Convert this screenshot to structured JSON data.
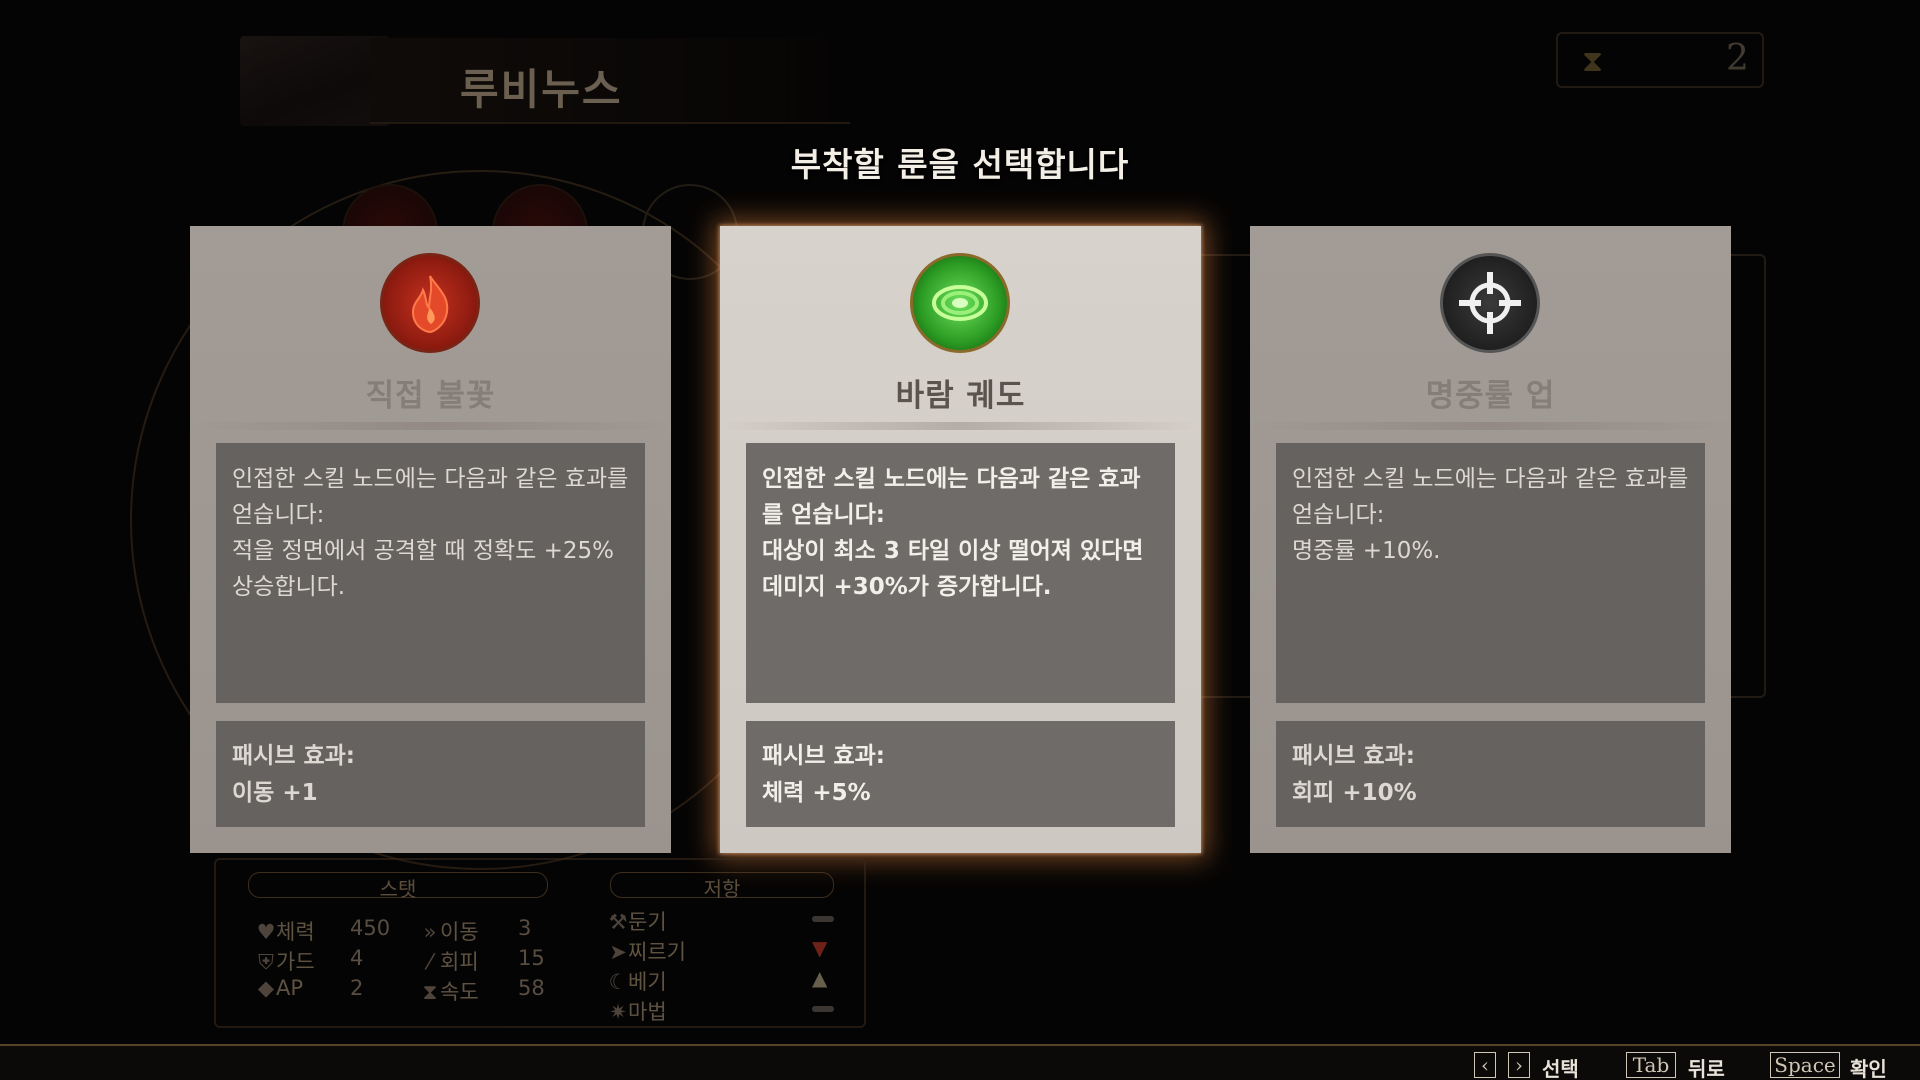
{
  "header": {
    "character_name": "루비누스",
    "currency_count": "2",
    "currency_icon": "hourglass-icon"
  },
  "title": "부착할 룬을 선택합니다",
  "cards": [
    {
      "icon": "fire-rune-icon",
      "name": "직접 불꽃",
      "description": "인접한 스킬 노드에는 다음과 같은 효과를 얻습니다:\n적을 정면에서 공격할 때 정확도 +25% 상승합니다.",
      "passive_label": "패시브 효과:",
      "passive_value": "이동 +1",
      "selected": false
    },
    {
      "icon": "wind-rune-icon",
      "name": "바람 궤도",
      "description": "인접한 스킬 노드에는 다음과 같은 효과를 얻습니다:\n대상이 최소 3 타일 이상 떨어져 있다면 데미지 +30%가 증가합니다.",
      "passive_label": "패시브 효과:",
      "passive_value": "체력 +5%",
      "selected": true
    },
    {
      "icon": "crosshair-rune-icon",
      "name": "명중률 업",
      "description": "인접한 스킬 노드에는 다음과 같은 효과를 얻습니다:\n명중률 +10%.",
      "passive_label": "패시브 효과:",
      "passive_value": "회피 +10%",
      "selected": false
    }
  ],
  "stats": {
    "stats_tab": "스탯",
    "resist_tab": "저항",
    "items": [
      {
        "label": "체력",
        "value": "450"
      },
      {
        "label": "가드",
        "value": "4"
      },
      {
        "label": "AP",
        "value": "2"
      },
      {
        "label": "이동",
        "value": "3"
      },
      {
        "label": "회피",
        "value": "15"
      },
      {
        "label": "속도",
        "value": "58"
      }
    ],
    "resistances": [
      {
        "label": "둔기",
        "state": "neutral"
      },
      {
        "label": "찌르기",
        "state": "weak"
      },
      {
        "label": "베기",
        "state": "strong"
      },
      {
        "label": "마법",
        "state": "neutral"
      }
    ]
  },
  "footer": {
    "select_label": "선택",
    "back_key": "Tab",
    "back_label": "뒤로",
    "confirm_key": "Space",
    "confirm_label": "확인"
  },
  "colors": {
    "accent_glow": "#ff9646",
    "card_bg": "#c5bdb6",
    "panel_bg": "#6e6b69"
  }
}
